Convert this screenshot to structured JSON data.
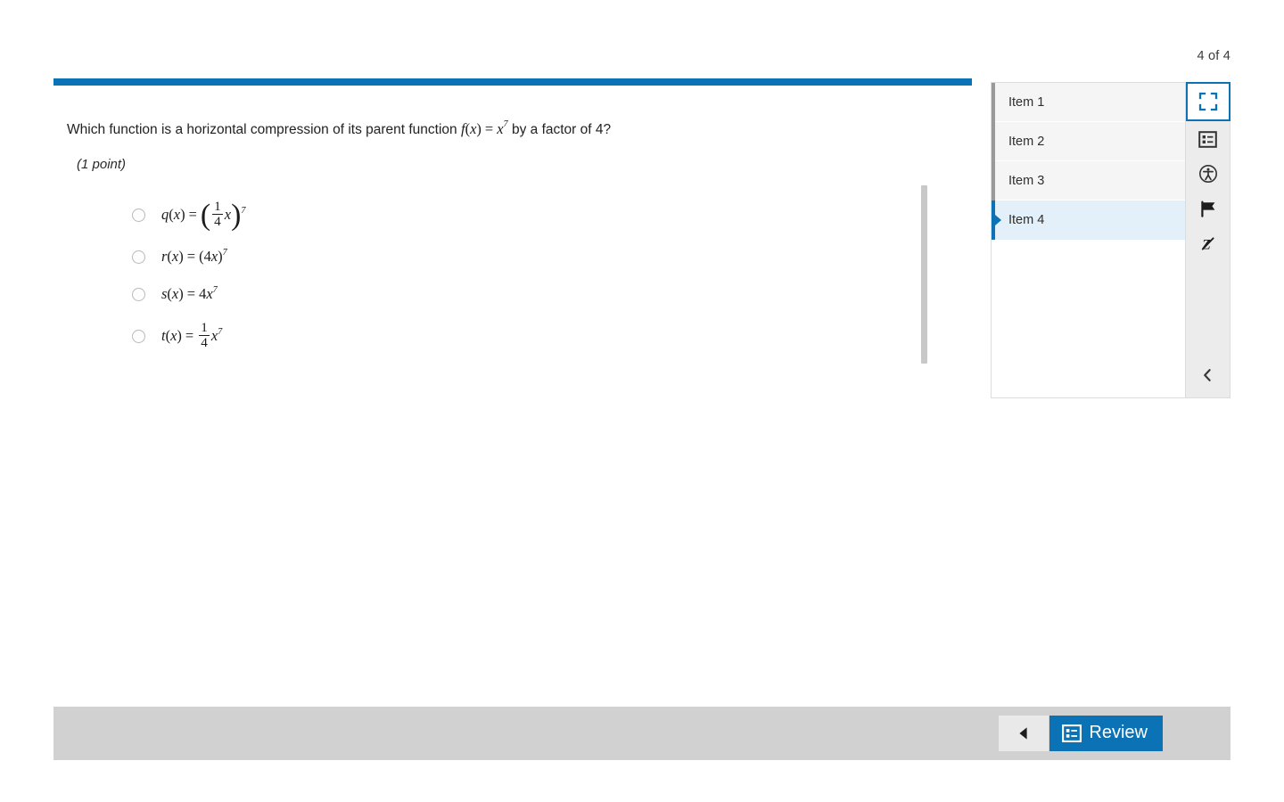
{
  "navigator": {
    "counter": "4 of 4",
    "items": [
      {
        "label": "Item 1",
        "selected": false
      },
      {
        "label": "Item 2",
        "selected": false
      },
      {
        "label": "Item 3",
        "selected": false
      },
      {
        "label": "Item 4",
        "selected": true
      }
    ],
    "tools": [
      {
        "name": "fullscreen-icon",
        "selected": true
      },
      {
        "name": "item-list-icon",
        "selected": false
      },
      {
        "name": "accessibility-icon",
        "selected": false
      },
      {
        "name": "flag-icon",
        "selected": false
      },
      {
        "name": "strikethrough-icon",
        "selected": false
      }
    ],
    "collapse_icon": "chevron-left-icon"
  },
  "question": {
    "stem_before": "Which function is a horizontal compression of its parent function ",
    "stem_math": {
      "fn": "f",
      "var": "x",
      "eq": "=",
      "base": "x",
      "exponent": "7"
    },
    "stem_after": " by a factor of 4?",
    "points": "(1 point)",
    "choices": [
      {
        "id": "choice-q",
        "fn": "q",
        "var": "x",
        "eq": "=",
        "form": "paren-frac-times-var-pow",
        "numerator": "1",
        "denominator": "4",
        "inner_var": "x",
        "exponent": "7",
        "selected": false
      },
      {
        "id": "choice-r",
        "fn": "r",
        "var": "x",
        "eq": "=",
        "form": "paren-coef-var-pow",
        "coefficient": "4",
        "inner_var": "x",
        "exponent": "7",
        "selected": false
      },
      {
        "id": "choice-s",
        "fn": "s",
        "var": "x",
        "eq": "=",
        "form": "coef-var-pow",
        "coefficient": "4",
        "inner_var": "x",
        "exponent": "7",
        "selected": false
      },
      {
        "id": "choice-t",
        "fn": "t",
        "var": "x",
        "eq": "=",
        "form": "frac-var-pow",
        "numerator": "1",
        "denominator": "4",
        "inner_var": "x",
        "exponent": "7",
        "selected": false
      }
    ]
  },
  "toolbar": {
    "prev_icon": "previous-triangle-icon",
    "review_label": "Review",
    "review_icon": "review-list-icon"
  },
  "colors": {
    "accent_blue": "#0b72b5",
    "selected_row": "#e3f0f9",
    "row_gray": "#f5f5f5",
    "toolbar_gray": "#d1d1d1"
  }
}
